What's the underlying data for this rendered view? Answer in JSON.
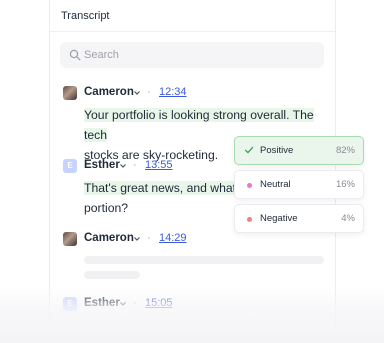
{
  "panel": {
    "title": "Transcript"
  },
  "search": {
    "placeholder": "Search"
  },
  "messages": [
    {
      "speaker": "Cameron",
      "time": "12:34",
      "avatar": "photo",
      "lines": [
        "Your portfolio is looking strong overall. The tech",
        "stocks are sky-rocketing."
      ]
    },
    {
      "speaker": "Esther",
      "time": "13:55",
      "avatar": "E",
      "lines": [
        "That's great news, and what ab",
        "portion?"
      ]
    },
    {
      "speaker": "Cameron",
      "time": "14:29",
      "avatar": "photo",
      "lines": []
    },
    {
      "speaker": "Esther",
      "time": "15:05",
      "avatar": "E",
      "lines": []
    }
  ],
  "sentiments": [
    {
      "label": "Positive",
      "value": "82%",
      "color": "#3f9b57",
      "selected": true
    },
    {
      "label": "Neutral",
      "value": "16%",
      "color": "#e879c5",
      "selected": false
    },
    {
      "label": "Negative",
      "value": "4%",
      "color": "#f08080",
      "selected": false
    }
  ],
  "colors": {
    "accent_link": "#3b5bdb",
    "highlight": "#e7f6e9",
    "positive_bg": "#eaf6ec"
  }
}
